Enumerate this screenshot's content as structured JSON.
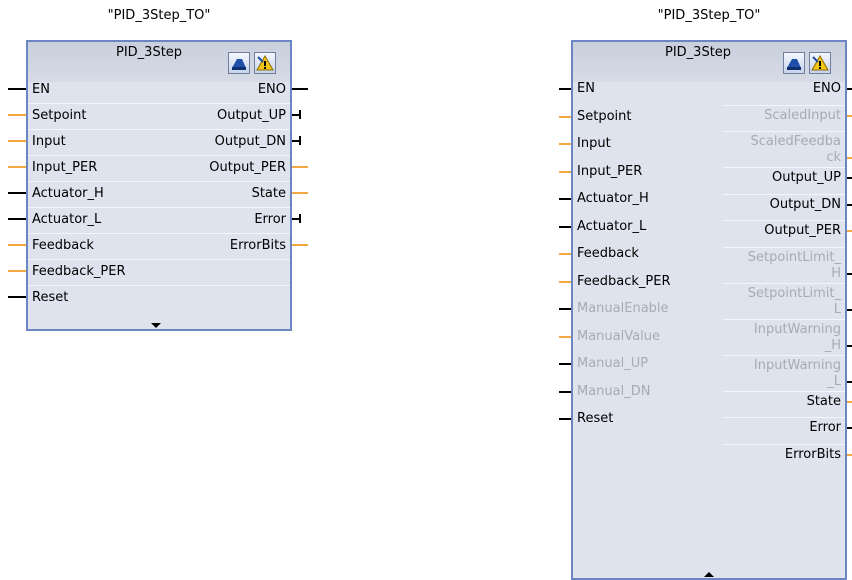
{
  "left_block": {
    "instance_name": "\"PID_3Step_TO\"",
    "type_name": "PID_3Step",
    "icons": [
      "commissioning-icon",
      "warning-icon"
    ],
    "inputs": [
      {
        "label": "EN",
        "wire": "black",
        "greyed": false
      },
      {
        "label": "Setpoint",
        "wire": "orange",
        "greyed": false
      },
      {
        "label": "Input",
        "wire": "orange",
        "greyed": false
      },
      {
        "label": "Input_PER",
        "wire": "orange",
        "greyed": false
      },
      {
        "label": "Actuator_H",
        "wire": "black",
        "greyed": false
      },
      {
        "label": "Actuator_L",
        "wire": "black",
        "greyed": false
      },
      {
        "label": "Feedback",
        "wire": "orange",
        "greyed": false
      },
      {
        "label": "Feedback_PER",
        "wire": "orange",
        "greyed": false
      },
      {
        "label": "Reset",
        "wire": "black",
        "greyed": false
      }
    ],
    "outputs": [
      {
        "label": "ENO",
        "wire": "black",
        "greyed": false,
        "end": "line"
      },
      {
        "label": "Output_UP",
        "wire": "black",
        "greyed": false,
        "end": "tick"
      },
      {
        "label": "Output_DN",
        "wire": "black",
        "greyed": false,
        "end": "tick"
      },
      {
        "label": "Output_PER",
        "wire": "orange",
        "greyed": false,
        "end": "line"
      },
      {
        "label": "State",
        "wire": "orange",
        "greyed": false,
        "end": "line"
      },
      {
        "label": "Error",
        "wire": "black",
        "greyed": false,
        "end": "tick"
      },
      {
        "label": "ErrorBits",
        "wire": "orange",
        "greyed": false,
        "end": "line"
      }
    ],
    "expand_arrow": "down"
  },
  "right_block": {
    "instance_name": "\"PID_3Step_TO\"",
    "type_name": "PID_3Step",
    "icons": [
      "commissioning-icon",
      "warning-icon"
    ],
    "inputs": [
      {
        "label": "EN",
        "wire": "black",
        "greyed": false
      },
      {
        "label": "Setpoint",
        "wire": "orange",
        "greyed": false
      },
      {
        "label": "Input",
        "wire": "orange",
        "greyed": false
      },
      {
        "label": "Input_PER",
        "wire": "orange",
        "greyed": false
      },
      {
        "label": "Actuator_H",
        "wire": "black",
        "greyed": false
      },
      {
        "label": "Actuator_L",
        "wire": "black",
        "greyed": false
      },
      {
        "label": "Feedback",
        "wire": "orange",
        "greyed": false
      },
      {
        "label": "Feedback_PER",
        "wire": "orange",
        "greyed": false
      },
      {
        "label": "ManualEnable",
        "wire": "black",
        "greyed": true
      },
      {
        "label": "ManualValue",
        "wire": "orange",
        "greyed": true
      },
      {
        "label": "Manual_UP",
        "wire": "black",
        "greyed": true
      },
      {
        "label": "Manual_DN",
        "wire": "black",
        "greyed": true
      },
      {
        "label": "Reset",
        "wire": "black",
        "greyed": false
      }
    ],
    "outputs": [
      {
        "lines": [
          "ENO"
        ],
        "wire": "black",
        "greyed": false
      },
      {
        "lines": [
          "ScaledInput"
        ],
        "wire": "orange",
        "greyed": true
      },
      {
        "lines": [
          "ScaledFeedba",
          "ck"
        ],
        "wire": "orange",
        "greyed": true
      },
      {
        "lines": [
          "Output_UP"
        ],
        "wire": "black",
        "greyed": false
      },
      {
        "lines": [
          "Output_DN"
        ],
        "wire": "black",
        "greyed": false
      },
      {
        "lines": [
          "Output_PER"
        ],
        "wire": "orange",
        "greyed": false
      },
      {
        "lines": [
          "SetpointLimit_",
          "H"
        ],
        "wire": "black",
        "greyed": true
      },
      {
        "lines": [
          "SetpointLimit_",
          "L"
        ],
        "wire": "black",
        "greyed": true
      },
      {
        "lines": [
          "InputWarning",
          "_H"
        ],
        "wire": "black",
        "greyed": true
      },
      {
        "lines": [
          "InputWarning",
          "_L"
        ],
        "wire": "black",
        "greyed": true
      },
      {
        "lines": [
          "State"
        ],
        "wire": "orange",
        "greyed": false
      },
      {
        "lines": [
          "Error"
        ],
        "wire": "black",
        "greyed": false
      },
      {
        "lines": [
          "ErrorBits"
        ],
        "wire": "orange",
        "greyed": false
      }
    ],
    "expand_arrow": "up"
  }
}
